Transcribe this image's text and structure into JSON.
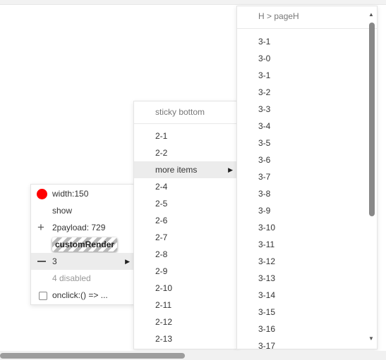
{
  "menu1": {
    "items": [
      {
        "label": "width:150",
        "icon": "red-dot-icon"
      },
      {
        "label": "show"
      },
      {
        "label": "2payload: 729",
        "icon": "plus-icon"
      },
      {
        "label": "customRender"
      },
      {
        "label": "3",
        "icon": "minus-icon",
        "has_submenu": true
      },
      {
        "label": "4 disabled",
        "disabled": true
      },
      {
        "label": "onclick:() => ...",
        "icon": "checkbox-icon"
      }
    ]
  },
  "menu2": {
    "sticky_label": "sticky bottom",
    "items": [
      "2-1",
      "2-2",
      "more items",
      "2-4",
      "2-5",
      "2-6",
      "2-7",
      "2-8",
      "2-9",
      "2-10",
      "2-11",
      "2-12",
      "2-13"
    ]
  },
  "menu3": {
    "header": "H > pageH",
    "items": [
      "3-1",
      "3-0",
      "3-1",
      "3-2",
      "3-3",
      "3-4",
      "3-5",
      "3-6",
      "3-7",
      "3-8",
      "3-9",
      "3-10",
      "3-11",
      "3-12",
      "3-13",
      "3-14",
      "3-15",
      "3-16",
      "3-17"
    ]
  },
  "colors": {
    "dot": "#ff0000",
    "hover_bg": "#ececec"
  },
  "scroll": {
    "vertical_fraction": 0.05,
    "horizontal_fraction": 0.0
  }
}
